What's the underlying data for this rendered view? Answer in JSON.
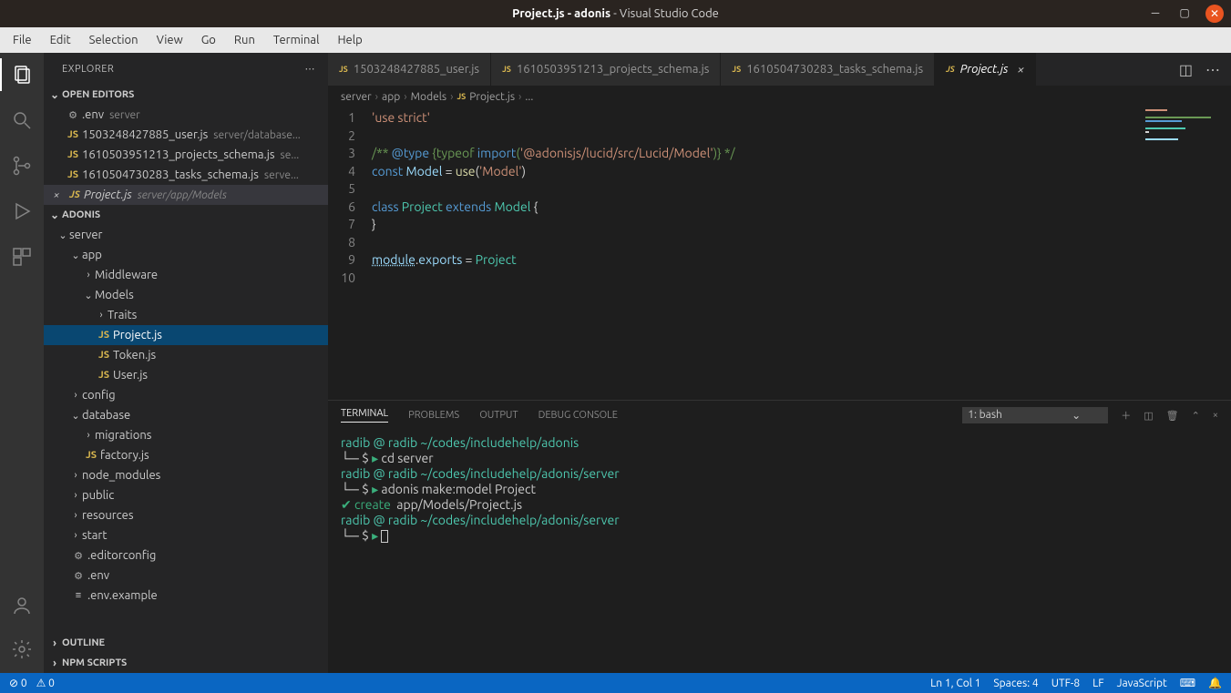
{
  "window": {
    "title_bold": "Project.js - adonis",
    "title_rest": " - Visual Studio Code"
  },
  "menu": [
    "File",
    "Edit",
    "Selection",
    "View",
    "Go",
    "Run",
    "Terminal",
    "Help"
  ],
  "explorer": {
    "title": "EXPLORER",
    "open_editors_label": "OPEN EDITORS",
    "open_editors": [
      {
        "name": ".env",
        "path": "server"
      },
      {
        "name": "1503248427885_user.js",
        "path": "server/database..."
      },
      {
        "name": "1610503951213_projects_schema.js",
        "path": "se..."
      },
      {
        "name": "1610504730283_tasks_schema.js",
        "path": "serve..."
      },
      {
        "name": "Project.js",
        "path": "server/app/Models",
        "active": true
      }
    ],
    "project_label": "ADONIS",
    "tree": {
      "server": "server",
      "app": "app",
      "middleware": "Middleware",
      "models": "Models",
      "traits": "Traits",
      "project_js": "Project.js",
      "token_js": "Token.js",
      "user_js": "User.js",
      "config": "config",
      "database": "database",
      "migrations": "migrations",
      "factory_js": "factory.js",
      "node_modules": "node_modules",
      "public": "public",
      "resources": "resources",
      "start": "start",
      "editorconfig": ".editorconfig",
      "env": ".env",
      "env_example": ".env.example"
    },
    "outline_label": "OUTLINE",
    "npm_scripts_label": "NPM SCRIPTS"
  },
  "tabs": [
    {
      "name": "1503248427885_user.js",
      "active": false
    },
    {
      "name": "1610503951213_projects_schema.js",
      "active": false
    },
    {
      "name": "1610504730283_tasks_schema.js",
      "active": false
    },
    {
      "name": "Project.js",
      "active": true
    }
  ],
  "breadcrumb": [
    "server",
    "app",
    "Models",
    "Project.js",
    "..."
  ],
  "code": {
    "lines": [
      "1",
      "2",
      "3",
      "4",
      "5",
      "6",
      "7",
      "8",
      "9",
      "10"
    ],
    "l1_str": "'use strict'",
    "l3_a": "/** ",
    "l3_b": "@type",
    "l3_c": " {typeof ",
    "l3_d": "import",
    "l3_e": "(",
    "l3_f": "'@adonisjs/lucid/src/Lucid/Model'",
    "l3_g": ")} */",
    "l4_const": "const",
    "l4_model": " Model ",
    "l4_eq": "= ",
    "l4_use": "use",
    "l4_p1": "(",
    "l4_s": "'Model'",
    "l4_p2": ")",
    "l6_class": "class",
    "l6_proj": " Project ",
    "l6_ext": "extends",
    "l6_model": " Model ",
    "l6_b": "{",
    "l7": "}",
    "l9_mod": "module",
    "l9_dot": ".",
    "l9_exp": "exports",
    "l9_eq": " = ",
    "l9_proj": "Project"
  },
  "panel": {
    "tabs": {
      "terminal": "TERMINAL",
      "problems": "PROBLEMS",
      "output": "OUTPUT",
      "debug": "DEBUG CONSOLE"
    },
    "select": "1: bash",
    "terminal_lines": {
      "p1": "radib @ radib ~/codes/includehelp/adonis",
      "cmd1": "cd server",
      "p2": "radib @ radib ~/codes/includehelp/adonis/server",
      "cmd2": "adonis make:model Project",
      "create_label": "create",
      "create_path": "  app/Models/Project.js",
      "p3": "radib @ radib ~/codes/includehelp/adonis/server",
      "box_l": "└─ ",
      "dollar": "$ ",
      "arrow": "▸ "
    }
  },
  "status": {
    "errors": "0",
    "warnings": "0",
    "ln_col": "Ln 1, Col 1",
    "spaces": "Spaces: 4",
    "encoding": "UTF-8",
    "eol": "LF",
    "lang": "JavaScript"
  }
}
